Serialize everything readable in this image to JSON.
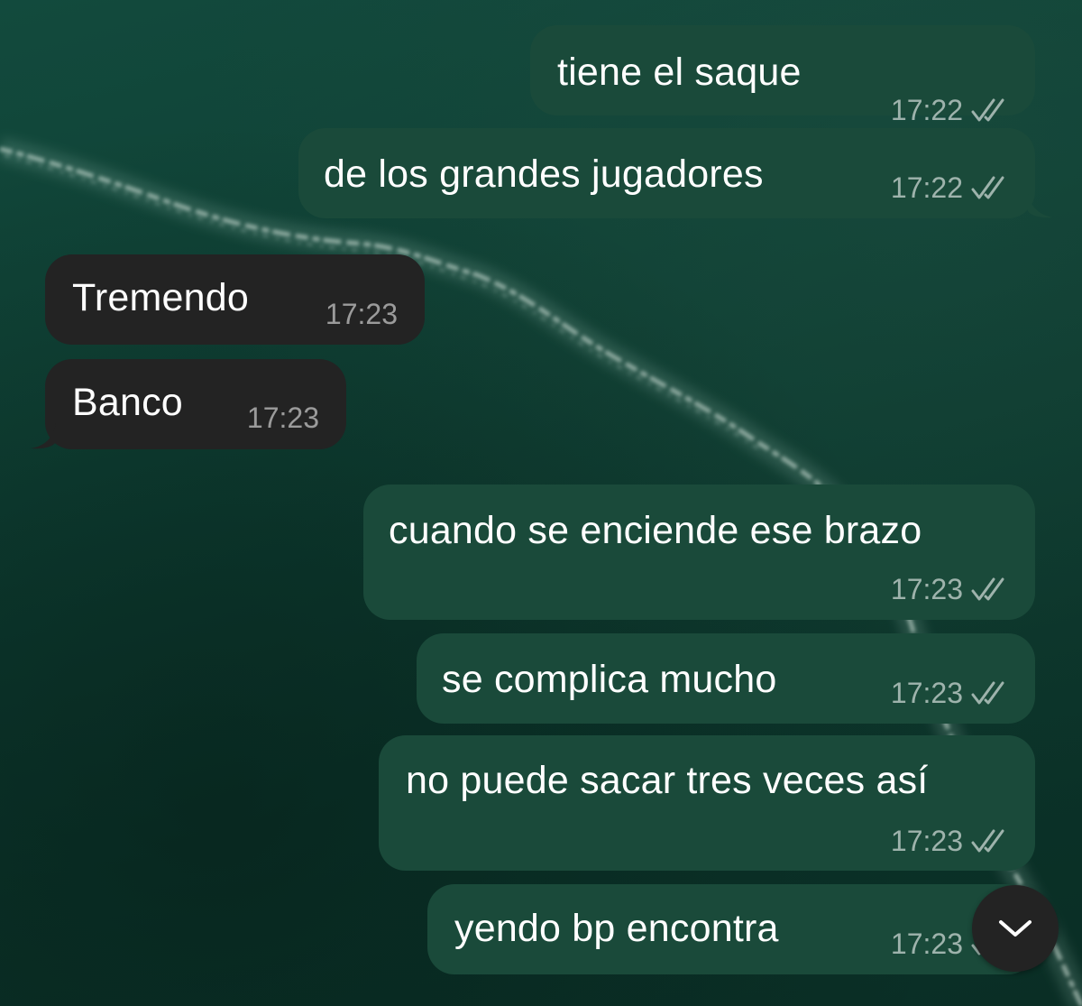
{
  "messages": [
    {
      "direction": "outgoing",
      "text": "tiene el saque",
      "time": "17:22",
      "status": "read"
    },
    {
      "direction": "outgoing",
      "text": "de los grandes jugadores",
      "time": "17:22",
      "status": "read"
    },
    {
      "direction": "incoming",
      "text": "Tremendo",
      "time": "17:23"
    },
    {
      "direction": "incoming",
      "text": "Banco",
      "time": "17:23"
    },
    {
      "direction": "outgoing",
      "text": "cuando se enciende ese brazo",
      "time": "17:23",
      "status": "read"
    },
    {
      "direction": "outgoing",
      "text": "se complica mucho",
      "time": "17:23",
      "status": "read"
    },
    {
      "direction": "outgoing",
      "text": "no puede sacar tres veces así",
      "time": "17:23",
      "status": "read"
    },
    {
      "direction": "outgoing",
      "text": "yendo bp encontra",
      "time": "17:23",
      "status": "read"
    }
  ],
  "scroll_button": {
    "icon": "chevron-down-icon"
  },
  "colors": {
    "outgoing_bubble": "#1a4a3a",
    "incoming_bubble": "#232323",
    "wallpaper": "#0f4034",
    "timestamp": "#a6b3ad"
  }
}
